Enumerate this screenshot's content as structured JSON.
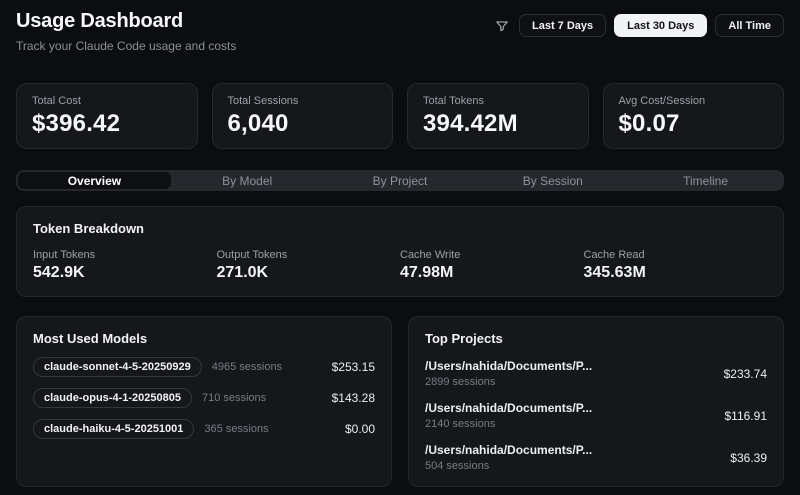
{
  "header": {
    "title": "Usage Dashboard",
    "subtitle": "Track your Claude Code usage and costs",
    "range_buttons": [
      {
        "label": "Last 7 Days",
        "active": false
      },
      {
        "label": "Last 30 Days",
        "active": true
      },
      {
        "label": "All Time",
        "active": false
      }
    ]
  },
  "stats": [
    {
      "label": "Total Cost",
      "value": "$396.42"
    },
    {
      "label": "Total Sessions",
      "value": "6,040"
    },
    {
      "label": "Total Tokens",
      "value": "394.42M"
    },
    {
      "label": "Avg Cost/Session",
      "value": "$0.07"
    }
  ],
  "tabs": [
    {
      "label": "Overview",
      "active": true
    },
    {
      "label": "By Model",
      "active": false
    },
    {
      "label": "By Project",
      "active": false
    },
    {
      "label": "By Session",
      "active": false
    },
    {
      "label": "Timeline",
      "active": false
    }
  ],
  "token_breakdown": {
    "title": "Token Breakdown",
    "items": [
      {
        "label": "Input Tokens",
        "value": "542.9K"
      },
      {
        "label": "Output Tokens",
        "value": "271.0K"
      },
      {
        "label": "Cache Write",
        "value": "47.98M"
      },
      {
        "label": "Cache Read",
        "value": "345.63M"
      }
    ]
  },
  "most_used_models": {
    "title": "Most Used Models",
    "rows": [
      {
        "model": "claude-sonnet-4-5-20250929",
        "sessions": "4965 sessions",
        "cost": "$253.15"
      },
      {
        "model": "claude-opus-4-1-20250805",
        "sessions": "710 sessions",
        "cost": "$143.28"
      },
      {
        "model": "claude-haiku-4-5-20251001",
        "sessions": "365 sessions",
        "cost": "$0.00"
      }
    ]
  },
  "top_projects": {
    "title": "Top Projects",
    "rows": [
      {
        "path": "/Users/nahida/Documents/P...",
        "sessions": "2899 sessions",
        "cost": "$233.74"
      },
      {
        "path": "/Users/nahida/Documents/P...",
        "sessions": "2140 sessions",
        "cost": "$116.91"
      },
      {
        "path": "/Users/nahida/Documents/P...",
        "sessions": "504 sessions",
        "cost": "$36.39"
      }
    ]
  },
  "colors": {
    "page_background": "#0b0d10",
    "card_background": "#15171b",
    "card_border": "#24272c",
    "active_button_background": "#f2f3f5",
    "primary_text": "#f7f8f9",
    "muted_text": "#9aa1a8"
  }
}
